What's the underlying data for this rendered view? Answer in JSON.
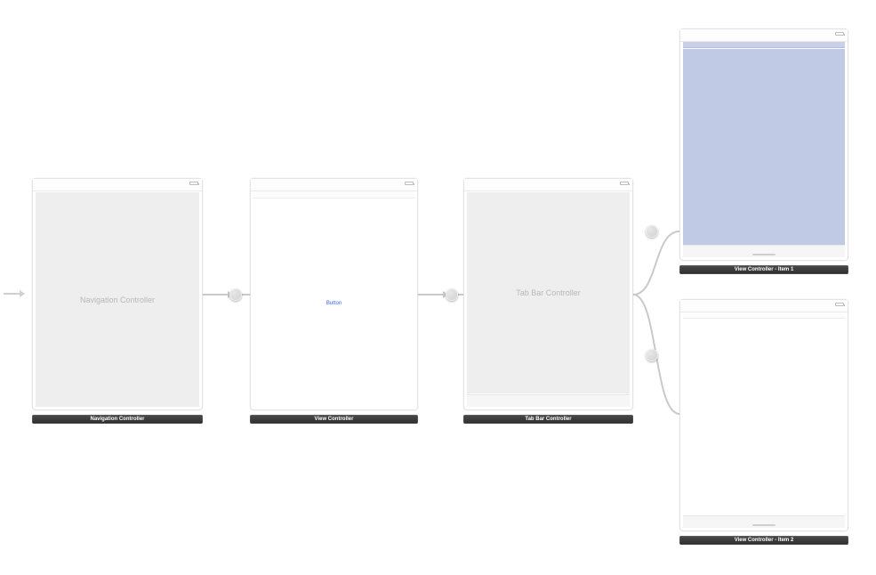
{
  "scenes": {
    "nav": {
      "title": "Navigation Controller",
      "center_label": "Navigation Controller"
    },
    "view": {
      "title": "View Controller",
      "button_label": "Button"
    },
    "tabbar": {
      "title": "Tab Bar Controller",
      "center_label": "Tab Bar Controller"
    },
    "item1": {
      "title": "View Controller - Item 1"
    },
    "item2": {
      "title": "View Controller - Item 2"
    }
  }
}
